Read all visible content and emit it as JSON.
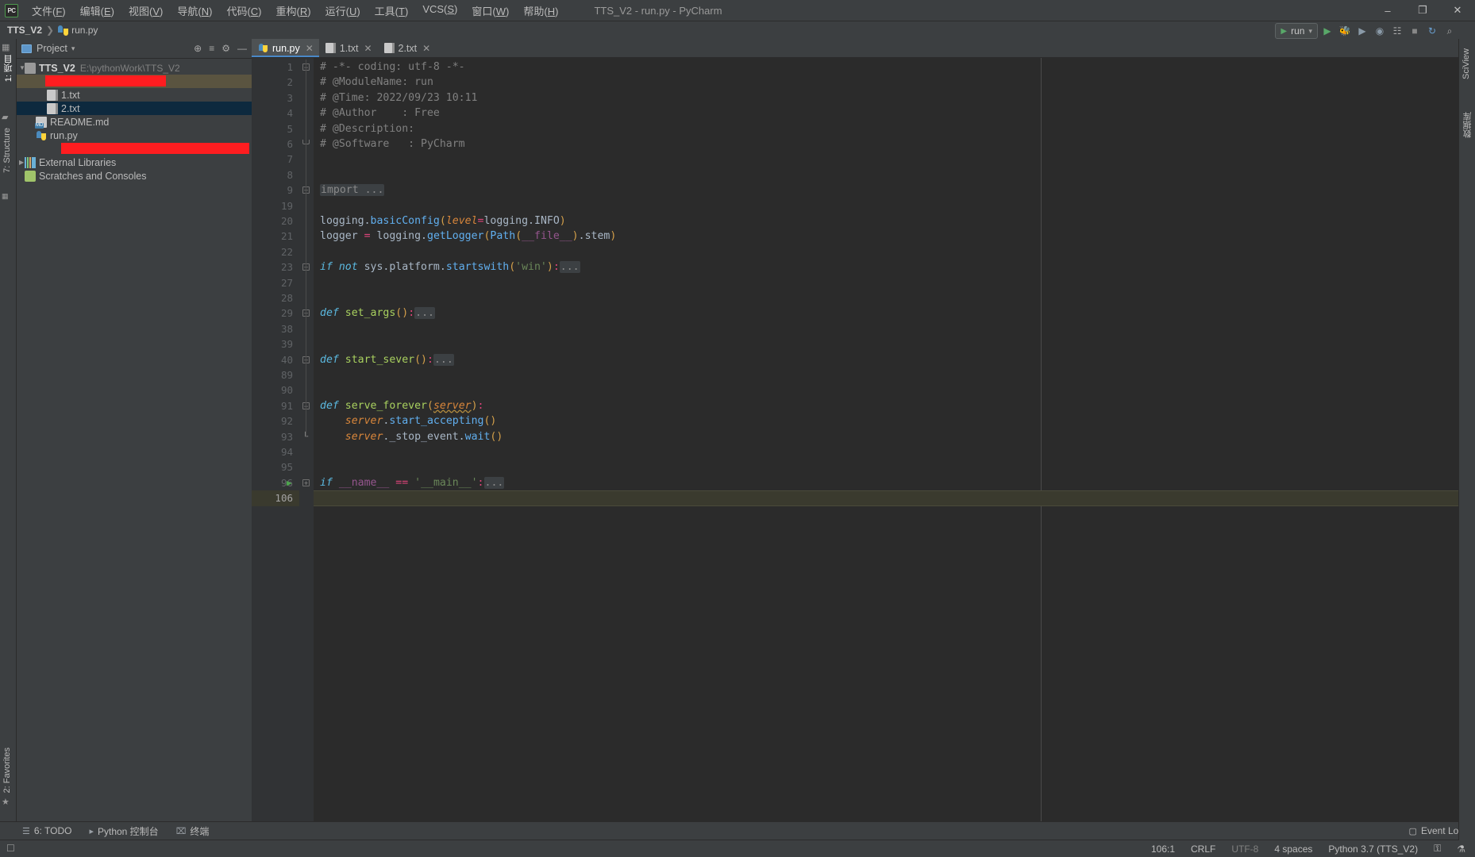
{
  "window": {
    "title": "TTS_V2 - run.py - PyCharm",
    "logo": "PC",
    "minimize": "–",
    "maximize": "❐",
    "close": "✕"
  },
  "menu": [
    {
      "label": "文件",
      "mnemonic": "F"
    },
    {
      "label": "编辑",
      "mnemonic": "E"
    },
    {
      "label": "视图",
      "mnemonic": "V"
    },
    {
      "label": "导航",
      "mnemonic": "N"
    },
    {
      "label": "代码",
      "mnemonic": "C"
    },
    {
      "label": "重构",
      "mnemonic": "R"
    },
    {
      "label": "运行",
      "mnemonic": "U"
    },
    {
      "label": "工具",
      "mnemonic": "T"
    },
    {
      "label": "VCS",
      "mnemonic": "S"
    },
    {
      "label": "窗口",
      "mnemonic": "W"
    },
    {
      "label": "帮助",
      "mnemonic": "H"
    }
  ],
  "breadcrumb": {
    "project": "TTS_V2",
    "separator": "❯",
    "file": "run.py"
  },
  "toolbar": {
    "run_config": "run",
    "chevron": "▾",
    "run": "▶",
    "debug": "⚙",
    "run_coverage": "▶",
    "profile": "◉",
    "attach": "☷",
    "stop": "■",
    "sync": "↻",
    "search": "⌕"
  },
  "left_strip": {
    "project_label": "1: 项目",
    "structure_label": "7: Structure",
    "favorites_label": "2: Favorites",
    "star_icon": "★",
    "grid_icon": "▦",
    "folder_icon": "▰",
    "terminal_icon": "⌨"
  },
  "right_strip": {
    "sciview_label": "SciView",
    "database_label": "数据库",
    "notifications_label": "通知"
  },
  "project_panel": {
    "title": "Project",
    "chevron": "▾",
    "locate_icon": "⊕",
    "collapse_icon": "≡",
    "settings_icon": "⚙",
    "hide_icon": "—",
    "tree": [
      {
        "label": "TTS_V2",
        "path": "E:\\pythonWork\\TTS_V2",
        "icon": "folder-icon",
        "indent": 0,
        "arrow": "▼",
        "bold": true,
        "selected": false,
        "redacted": false
      },
      {
        "label": "",
        "path": "",
        "icon": "redacted",
        "indent": 1,
        "arrow": "",
        "bold": false,
        "selected": false,
        "redacted": true
      },
      {
        "label": "1.txt",
        "path": "",
        "icon": "txt-icon",
        "indent": 2,
        "arrow": "",
        "bold": false,
        "selected": false,
        "redacted": false
      },
      {
        "label": "2.txt",
        "path": "",
        "icon": "txt-icon",
        "indent": 2,
        "arrow": "",
        "bold": false,
        "selected": true,
        "redacted": false
      },
      {
        "label": "README.md",
        "path": "",
        "icon": "markdown-icon",
        "indent": 1,
        "arrow": "",
        "bold": false,
        "selected": false,
        "redacted": false
      },
      {
        "label": "run.py",
        "path": "",
        "icon": "python-icon",
        "indent": 1,
        "arrow": "",
        "bold": false,
        "selected": false,
        "redacted": false
      },
      {
        "label": "",
        "path": "",
        "icon": "redacted",
        "indent": 1,
        "arrow": "",
        "bold": false,
        "selected": false,
        "redacted": true
      },
      {
        "label": "External Libraries",
        "path": "",
        "icon": "library-icon",
        "indent": 0,
        "arrow": "▶",
        "bold": false,
        "selected": false,
        "redacted": false
      },
      {
        "label": "Scratches and Consoles",
        "path": "",
        "icon": "scratch-icon",
        "indent": 0,
        "arrow": "",
        "bold": false,
        "selected": false,
        "redacted": false
      }
    ]
  },
  "tabs": [
    {
      "label": "run.py",
      "icon": "python-icon",
      "active": true,
      "close": "✕"
    },
    {
      "label": "1.txt",
      "icon": "txt-icon",
      "active": false,
      "close": "✕"
    },
    {
      "label": "2.txt",
      "icon": "txt-icon",
      "active": false,
      "close": "✕"
    }
  ],
  "editor": {
    "current_line": 106,
    "lines": [
      {
        "num": "1",
        "fold": "minus",
        "html": "<span class='cmt'># -*- coding: utf-8 -*-</span>"
      },
      {
        "num": "2",
        "fold": "",
        "html": "<span class='cmt'># @ModuleName: run</span>"
      },
      {
        "num": "3",
        "fold": "",
        "html": "<span class='cmt'># @Time: 2022/09/23 10:11</span>"
      },
      {
        "num": "4",
        "fold": "",
        "html": "<span class='cmt'># @Author    : Free</span>"
      },
      {
        "num": "5",
        "fold": "",
        "html": "<span class='cmt'># @Description:</span>"
      },
      {
        "num": "6",
        "fold": "end",
        "html": "<span class='cmt'># @Software   : PyCharm</span>"
      },
      {
        "num": "7",
        "fold": "",
        "html": ""
      },
      {
        "num": "8",
        "fold": "",
        "html": ""
      },
      {
        "num": "9",
        "fold": "plus",
        "html": "<span class='folded'>import ...</span>"
      },
      {
        "num": "19",
        "fold": "",
        "html": ""
      },
      {
        "num": "20",
        "fold": "",
        "html": "<span class='var'>logging</span><span class='var'>.</span><span class='call'>basicConfig</span><span class='par'>(</span><span class='prm'>level</span><span class='op'>=</span><span class='var'>logging.INFO</span><span class='par'>)</span>"
      },
      {
        "num": "21",
        "fold": "",
        "html": "<span class='var'>logger </span><span class='op'>=</span><span class='var'> logging.</span><span class='call'>getLogger</span><span class='par'>(</span><span class='call'>Path</span><span class='par'>(</span><span class='self'>__file__</span><span class='par'>)</span><span class='var'>.stem</span><span class='par'>)</span>"
      },
      {
        "num": "22",
        "fold": "",
        "html": ""
      },
      {
        "num": "23",
        "fold": "plus",
        "html": "<span class='kwb'>if </span><span class='kwb'>not</span><span class='var'> sys.platform.</span><span class='call'>startswith</span><span class='par'>(</span><span class='str'>'win'</span><span class='par'>)</span><span class='op'>:</span><span class='folded'>...</span>"
      },
      {
        "num": "27",
        "fold": "",
        "html": ""
      },
      {
        "num": "28",
        "fold": "",
        "html": ""
      },
      {
        "num": "29",
        "fold": "plus",
        "html": "<span class='kwb'>def </span><span class='fndef'>set_args</span><span class='par'>()</span><span class='op'>:</span><span class='folded'>...</span>"
      },
      {
        "num": "38",
        "fold": "",
        "html": ""
      },
      {
        "num": "39",
        "fold": "",
        "html": ""
      },
      {
        "num": "40",
        "fold": "plus",
        "html": "<span class='kwb'>def </span><span class='fndef'>start_sever</span><span class='par'>()</span><span class='op'>:</span><span class='folded'>...</span>"
      },
      {
        "num": "89",
        "fold": "",
        "html": ""
      },
      {
        "num": "90",
        "fold": "",
        "html": ""
      },
      {
        "num": "91",
        "fold": "minus",
        "html": "<span class='kwb'>def </span><span class='fndef'>serve_forever</span><span class='par'>(</span><span class='prm squiggle'>server</span><span class='par'>)</span><span class='op'>:</span>"
      },
      {
        "num": "92",
        "fold": "",
        "html": "    <span class='prm'>server</span><span class='var'>.</span><span class='call'>start_accepting</span><span class='par'>()</span>"
      },
      {
        "num": "93",
        "fold": "lock",
        "html": "    <span class='prm'>server</span><span class='var'>._stop_event.</span><span class='call'>wait</span><span class='par'>()</span>"
      },
      {
        "num": "94",
        "fold": "",
        "html": ""
      },
      {
        "num": "95",
        "fold": "",
        "html": ""
      },
      {
        "num": "96",
        "fold": "plus",
        "run": true,
        "html": "<span class='kwb'>if </span><span class='self'>__name__ </span><span class='op'>==</span><span class='var'> </span><span class='str'>'__main__'</span><span class='op'>:</span><span class='folded'>...</span>"
      },
      {
        "num": "106",
        "fold": "",
        "current": true,
        "html": ""
      }
    ]
  },
  "bottom_tools": [
    {
      "label": "6: TODO",
      "icon": "todo-icon"
    },
    {
      "label": "Python 控制台",
      "icon": "python-console-icon"
    },
    {
      "label": "终端",
      "icon": "terminal-icon"
    }
  ],
  "event_log": {
    "label": "Event Log",
    "icon": "balloon-icon"
  },
  "statusbar": {
    "caret": "106:1",
    "line_separator": "CRLF",
    "encoding": "UTF-8",
    "indent": "4 spaces",
    "interpreter": "Python 3.7 (TTS_V2)",
    "lock_icon": "⚿",
    "inspection_icon": "⚗"
  },
  "colors": {
    "accent": "#4a88c7",
    "redaction": "#fe1d20",
    "selection": "#0d293e",
    "editor_bg": "#2b2b2b",
    "panel_bg": "#3c3f41",
    "gutter_bg": "#313335"
  }
}
